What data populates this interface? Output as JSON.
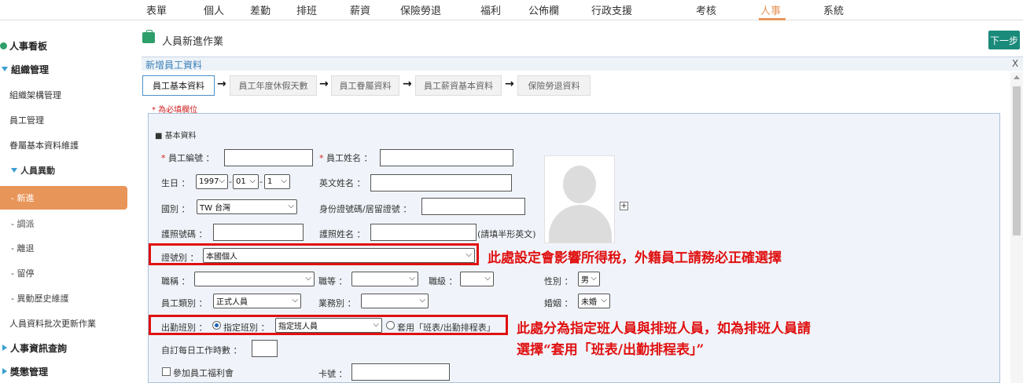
{
  "topnav": {
    "items": [
      "表單",
      "個人",
      "差勤",
      "排班",
      "薪資",
      "保險勞退",
      "福利",
      "公佈欄",
      "行政支援",
      "考核",
      "人事",
      "系統"
    ],
    "active": "人事",
    "accent_color": "#e8955a"
  },
  "sidebar": {
    "dashboard": "人事看板",
    "org_mgmt": "組織管理",
    "org_structure": "組織架構管理",
    "emp_mgmt": "員工管理",
    "rank_basic": "眷屬基本資料維護",
    "personnel_change": "人員異動",
    "sub": {
      "new": "- 新進",
      "transfer": "- 調派",
      "leave": "- 離退",
      "suspend": "- 留停",
      "history": "- 異動歷史維護"
    },
    "batch_update": "人員資料批次更新作業",
    "hr_query": "人事資訊查詢",
    "reward": "獎懲管理"
  },
  "main": {
    "page_title": "人員新進作業",
    "next_label": "下一步",
    "section_title": "新增員工資料",
    "close_label": "X",
    "steps": [
      "員工基本資料",
      "員工年度休假天數",
      "員工眷屬資料",
      "員工薪資基本資料",
      "保險勞退資料"
    ],
    "arrow": "→",
    "required_note": "* 為必填欄位"
  },
  "form": {
    "group_label": "■ 基本資料",
    "emp_no_label": "員工編號",
    "emp_name_label": "員工姓名",
    "birthday_label": "生日",
    "birth_year": "1997",
    "birth_month": "01",
    "birth_day": "1",
    "en_name_label": "英文姓名",
    "nationality_label": "國別",
    "nationality_value": "TW 台灣",
    "id_no_label": "身份證號碼/居留證號",
    "passport_no_label": "護照號碼",
    "passport_name_label": "護照姓名",
    "passport_name_hint": "(請填半形英文)",
    "id_type_label": "證號別",
    "id_type_value": "本國個人",
    "title_label": "職稱",
    "grade_label": "職等",
    "level_label": "職級",
    "gender_label": "性別",
    "gender_value": "男",
    "emp_type_label": "員工類別",
    "emp_type_value": "正式人員",
    "business_label": "業務別",
    "marital_label": "婚姻",
    "marital_value": "未婚",
    "shift_label": "出勤班別",
    "shift_option1": "指定班別",
    "shift_option1_value": "指定班人員",
    "shift_option2": "套用「班表/出勤排程表」",
    "daily_hours_label": "自訂每日工作時數",
    "welfare_label": "參加員工福利會",
    "card_no_label": "卡號"
  },
  "annotations": {
    "note1": "此處設定會影響所得稅，外籍員工請務必正確選擇",
    "note2_line1": "此處分為指定班人員與排班人員，如為排班人員請",
    "note2_line2": "選擇“套用「班表/出勤排程表」”",
    "color": "#e01010"
  }
}
